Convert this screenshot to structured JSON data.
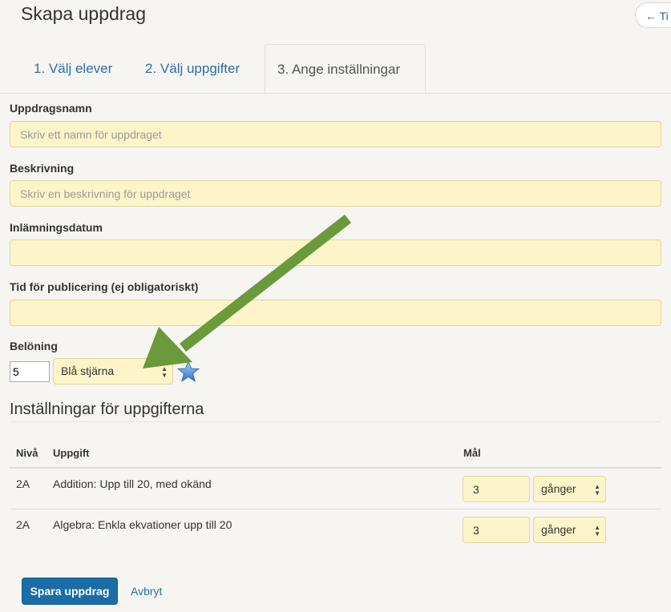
{
  "header": {
    "title": "Skapa uppdrag",
    "back_label": "← Ti"
  },
  "tabs": [
    {
      "label": "1. Välj elever",
      "active": false
    },
    {
      "label": "2. Välj uppgifter",
      "active": false
    },
    {
      "label": "3. Ange inställningar",
      "active": true
    }
  ],
  "form": {
    "name": {
      "label": "Uppdragsnamn",
      "placeholder": "Skriv ett namn för uppdraget",
      "value": ""
    },
    "description": {
      "label": "Beskrivning",
      "placeholder": "Skriv en beskrivning för uppdraget",
      "value": ""
    },
    "due_date": {
      "label": "Inlämningsdatum",
      "value": ""
    },
    "publish_time": {
      "label": "Tid för publicering (ej obligatoriskt)",
      "value": ""
    },
    "reward": {
      "label": "Belöning",
      "quantity": "5",
      "type": "Blå stjärna",
      "icon": "star-icon"
    }
  },
  "task_settings": {
    "heading": "Inställningar för uppgifterna",
    "columns": [
      "Nivå",
      "Uppgift",
      "Mål"
    ],
    "rows": [
      {
        "level": "2A",
        "task": "Addition: Upp till 20, med okänd",
        "goal": "3",
        "unit": "gånger"
      },
      {
        "level": "2A",
        "task": "Algebra: Enkla ekvationer upp till 20",
        "goal": "3",
        "unit": "gånger"
      }
    ]
  },
  "actions": {
    "save_label": "Spara uppdrag",
    "cancel_label": "Avbryt"
  },
  "colors": {
    "input_bg": "#fdf5c9",
    "primary": "#1a6da6",
    "link": "#2a6fa8",
    "annotation_arrow": "#6a9a3a"
  }
}
